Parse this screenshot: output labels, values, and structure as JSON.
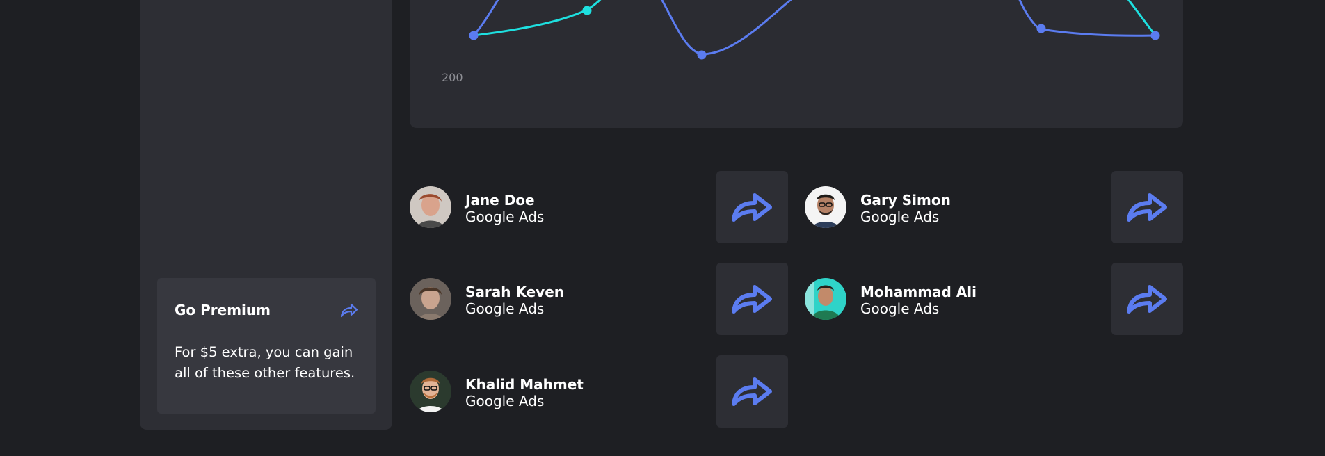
{
  "colors": {
    "background": "#1e1f23",
    "panel": "#2d2e34",
    "accent_blue": "#5b7cf0",
    "accent_cyan": "#1ee0e0"
  },
  "sidebar": {
    "premium": {
      "title": "Go Premium",
      "icon": "share-arrow-icon",
      "text": "For $5 extra, you can gain all of these other features."
    }
  },
  "chart": {
    "visible_tick_label": "200"
  },
  "contacts": [
    {
      "name": "Jane Doe",
      "subtitle": "Google Ads",
      "action_icon": "share-arrow-icon"
    },
    {
      "name": "Gary Simon",
      "subtitle": "Google Ads",
      "action_icon": "share-arrow-icon"
    },
    {
      "name": "Sarah Keven",
      "subtitle": "Google Ads",
      "action_icon": "share-arrow-icon"
    },
    {
      "name": "Mohammad Ali",
      "subtitle": "Google Ads",
      "action_icon": "share-arrow-icon"
    },
    {
      "name": "Khalid Mahmet",
      "subtitle": "Google Ads",
      "action_icon": "share-arrow-icon"
    }
  ]
}
